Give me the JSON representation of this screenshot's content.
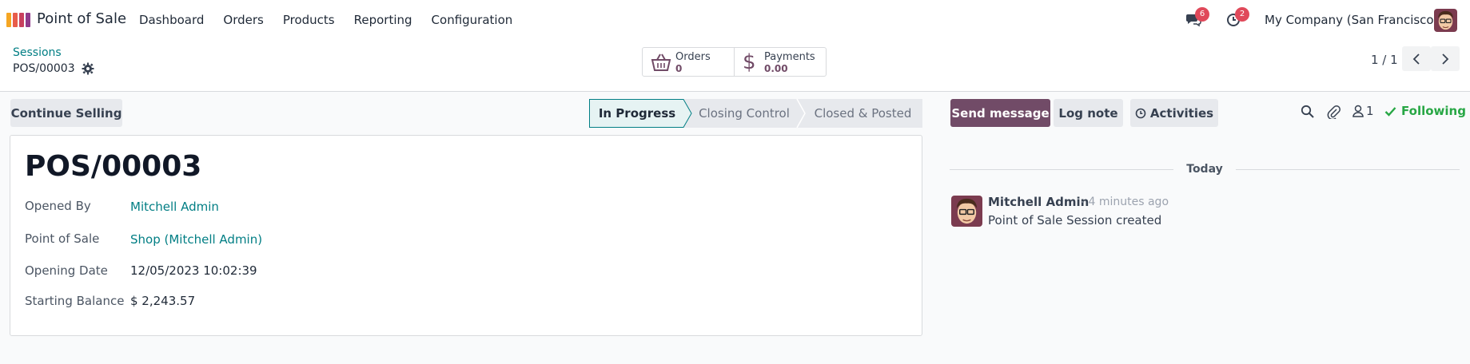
{
  "navbar": {
    "app_name": "Point of Sale",
    "menu": [
      "Dashboard",
      "Orders",
      "Products",
      "Reporting",
      "Configuration"
    ],
    "messages_badge": "6",
    "activities_badge": "2",
    "company": "My Company (San Francisco)"
  },
  "control_panel": {
    "breadcrumb_parent": "Sessions",
    "breadcrumb_current": "POS/00003",
    "orders_label": "Orders",
    "orders_value": "0",
    "payments_label": "Payments",
    "payments_value": "0.00",
    "pager": "1 / 1"
  },
  "form": {
    "continue_selling": "Continue Selling",
    "stages": [
      "In Progress",
      "Closing Control",
      "Closed & Posted"
    ],
    "active_stage": "In Progress",
    "title": "POS/00003",
    "fields": {
      "opened_by_label": "Opened By",
      "opened_by_value": "Mitchell Admin",
      "pos_label": "Point of Sale",
      "pos_value": "Shop (Mitchell Admin)",
      "opening_date_label": "Opening Date",
      "opening_date_value": "12/05/2023 10:02:39",
      "starting_balance_label": "Starting Balance",
      "starting_balance_value": "$ 2,243.57"
    }
  },
  "chatter": {
    "send_message": "Send message",
    "log_note": "Log note",
    "activities": "Activities",
    "followers_count": "1",
    "following": "Following",
    "date_separator": "Today",
    "message": {
      "author": "Mitchell Admin",
      "time": "- 4 minutes ago",
      "body": "Point of Sale Session created"
    }
  },
  "colors": {
    "brand": "#714b67",
    "link": "#017e84",
    "badge": "#e0495a",
    "following": "#28a745"
  }
}
